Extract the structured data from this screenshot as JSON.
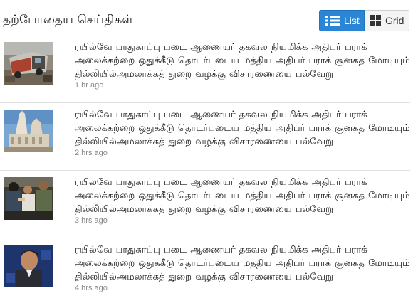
{
  "header": {
    "title": "தற்போதைய செய்திகள்",
    "list_label": "List",
    "grid_label": "Grid",
    "active_view": "List",
    "accent_color": "#2a86d4"
  },
  "news": [
    {
      "line1": "ரயில்வே பாதுகாப்பு படை ஆணையர் தகவல நியமிக்க  அதிபர் பராக்",
      "line2": "அலைக்கற்றை ஒதுக்கீடு தொடர்புடைய மத்திய  அதிபர் பராக் சூனகத மோடியும்",
      "line3": "தில்லியில்அமலாக்கத் துறை வழக்கு விசாரணையை பல்வேறு",
      "time": "1 hr ago",
      "thumb_subject": "truck-accident-image"
    },
    {
      "line1": "ரயில்வே பாதுகாப்பு படை ஆணையர் தகவல நியமிக்க  அதிபர் பராக்",
      "line2": "அலைக்கற்றை ஒதுக்கீடு தொடர்புடைய மத்திய  அதிபர் பராக் சூனகத மோடியும்",
      "line3": "தில்லியில்அமலாக்கத் துறை வழக்கு விசாரணையை பல்வேறு",
      "time": "2 hrs ago",
      "thumb_subject": "temple-image"
    },
    {
      "line1": "ரயில்வே பாதுகாப்பு படை ஆணையர் தகவல நியமிக்க  அதிபர் பராக்",
      "line2": "அலைக்கற்றை ஒதுக்கீடு தொடர்புடைய மத்திய  அதிபர் பராக் சூனகத மோடியும்",
      "line3": "தில்லியில்அமலாக்கத் துறை வழக்கு விசாரணையை பல்வேறு",
      "time": "3 hrs ago",
      "thumb_subject": "crowd-police-image"
    },
    {
      "line1": "ரயில்வே பாதுகாப்பு படை ஆணையர் தகவல நியமிக்க  அதிபர் பராக்",
      "line2": "அலைக்கற்றை ஒதுக்கீடு தொடர்புடைய மத்திய  அதிபர் பராக் சூனகத மோடியும்",
      "line3": "தில்லியில்அமலாக்கத் துறை வழக்கு விசாரணையை பல்வேறு",
      "time": "4 hrs ago",
      "thumb_subject": "person-portrait-image"
    }
  ]
}
